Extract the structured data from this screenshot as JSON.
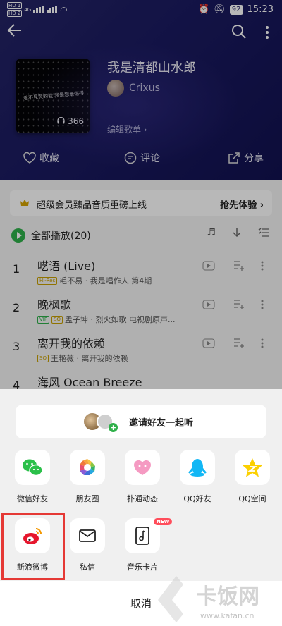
{
  "status_bar": {
    "time": "15:23",
    "battery": "92",
    "network": "4G",
    "sim": [
      "HD 1",
      "HD 2"
    ]
  },
  "playlist": {
    "title": "我是清都山水郎",
    "owner": "Crixus",
    "edit_label": "编辑歌单",
    "cover_text": "看不見哭的我 我是想最傷得",
    "play_count": "366",
    "actions": {
      "collect": "收藏",
      "comment": "评论",
      "share": "分享"
    }
  },
  "vip_banner": {
    "text": "超级会员臻品音质重磅上线",
    "action": "抢先体验"
  },
  "play_all": {
    "label": "全部播放",
    "count": "(20)"
  },
  "songs": [
    {
      "num": "1",
      "name": "呓语 (Live)",
      "tag": "Hi-Res",
      "meta": "毛不易 · 我是唱作人 第4期"
    },
    {
      "num": "2",
      "name": "晚枫歌",
      "tags": [
        "VIP",
        "SQ"
      ],
      "meta": "孟子坤 · 烈火如歌 电视剧原声..."
    },
    {
      "num": "3",
      "name": "离开我的依赖",
      "tag": "SQ",
      "meta": "王艳薇 · 离开我的依赖"
    },
    {
      "num": "4",
      "name": "海风 Ocean Breeze"
    }
  ],
  "share_sheet": {
    "invite_text": "邀请好友一起听",
    "row1": [
      "微信好友",
      "朋友圈",
      "扑通动态",
      "QQ好友",
      "QQ空间"
    ],
    "row2": [
      "新浪微博",
      "私信",
      "音乐卡片"
    ],
    "new_badge": "NEW",
    "cancel": "取消"
  },
  "watermark": {
    "brand": "卡饭网",
    "url": "www.kafan.cn"
  },
  "colors": {
    "header_bg": "#1c1c5e",
    "green": "#2fb04a",
    "highlight": "#e53935",
    "weibo_red": "#e6162d",
    "qq_blue": "#12b7f5",
    "qzone_yellow": "#fcd000"
  }
}
